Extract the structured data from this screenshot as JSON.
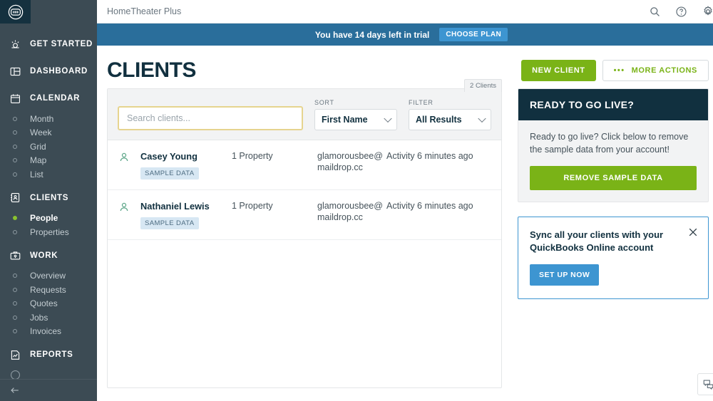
{
  "sidebar": {
    "logo_name": "app-logo",
    "sections": [
      {
        "label": "GET STARTED",
        "icon": "sun-icon",
        "subs": []
      },
      {
        "label": "DASHBOARD",
        "icon": "dashboard-icon",
        "subs": []
      },
      {
        "label": "CALENDAR",
        "icon": "calendar-icon",
        "subs": [
          {
            "label": "Month",
            "active": false
          },
          {
            "label": "Week",
            "active": false
          },
          {
            "label": "Grid",
            "active": false
          },
          {
            "label": "Map",
            "active": false
          },
          {
            "label": "List",
            "active": false
          }
        ]
      },
      {
        "label": "CLIENTS",
        "icon": "contact-card-icon",
        "subs": [
          {
            "label": "People",
            "active": true
          },
          {
            "label": "Properties",
            "active": false
          }
        ]
      },
      {
        "label": "WORK",
        "icon": "briefcase-icon",
        "subs": [
          {
            "label": "Overview",
            "active": false
          },
          {
            "label": "Requests",
            "active": false
          },
          {
            "label": "Quotes",
            "active": false
          },
          {
            "label": "Jobs",
            "active": false
          },
          {
            "label": "Invoices",
            "active": false
          }
        ]
      },
      {
        "label": "REPORTS",
        "icon": "report-chart-icon",
        "subs": []
      }
    ],
    "collapse_icon": "back-arrow-icon"
  },
  "topbar": {
    "app_title": "HomeTheater Plus",
    "icons": [
      "search-icon",
      "help-circle-icon",
      "gear-icon"
    ]
  },
  "trial": {
    "message": "You have 14 days left in trial",
    "cta_label": "CHOOSE PLAN"
  },
  "page": {
    "title": "CLIENTS",
    "new_client_label": "NEW CLIENT",
    "more_actions_label": "MORE ACTIONS",
    "more_actions_icon": "ellipsis-icon"
  },
  "clients_panel": {
    "count_label": "2 Clients",
    "search": {
      "placeholder": "Search clients...",
      "value": ""
    },
    "sort": {
      "label": "SORT",
      "value": "First Name"
    },
    "filter": {
      "label": "FILTER",
      "value": "All Results"
    },
    "rows": [
      {
        "avatar_icon": "person-icon",
        "name": "Casey Young",
        "badge": "SAMPLE DATA",
        "properties": "1 Property",
        "email": "glamorousbee@maildrop.cc",
        "activity": "Activity 6 minutes ago"
      },
      {
        "avatar_icon": "person-icon",
        "name": "Nathaniel Lewis",
        "badge": "SAMPLE DATA",
        "properties": "1 Property",
        "email": "glamorousbee@maildrop.cc",
        "activity": "Activity 6 minutes ago"
      }
    ]
  },
  "rail": {
    "go_live": {
      "heading": "READY TO GO LIVE?",
      "body": "Ready to go live? Click below to remove the sample data from your account!",
      "button_label": "REMOVE SAMPLE DATA"
    },
    "sync": {
      "title": "Sync all your clients with your QuickBooks Online account",
      "button_label": "SET UP NOW",
      "close_icon": "close-icon"
    }
  },
  "chat": {
    "icon": "chat-bubbles-icon"
  },
  "colors": {
    "sidebar_bg": "#3c4b54",
    "logo_bg": "#15313f",
    "trial_bg": "#2a6e9b",
    "accent_blue": "#3d95d1",
    "accent_green": "#7ab317",
    "dark_navy": "#11303f",
    "badge_bg": "#d7e7f3",
    "search_border": "#e6d48f",
    "active_dot": "#8ac22e"
  }
}
